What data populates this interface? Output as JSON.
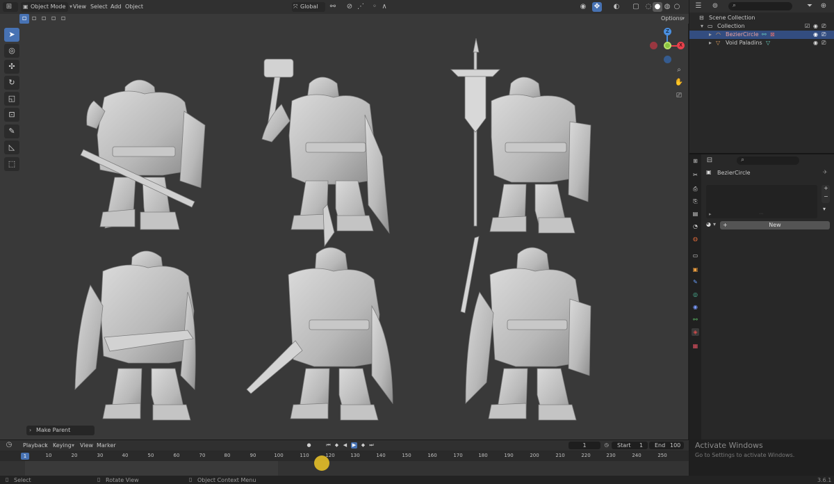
{
  "viewport": {
    "header": {
      "mode_label": "Object Mode",
      "menus": [
        "View",
        "Select",
        "Add",
        "Object"
      ],
      "transform_orientation": "Global",
      "options_label": "Options"
    },
    "toolbar": {
      "tools": [
        "select-box",
        "cursor",
        "move",
        "rotate",
        "scale",
        "transform",
        "annotate",
        "measure",
        "add-cube"
      ]
    },
    "gizmo": {
      "axes": [
        "X",
        "Y",
        "Z"
      ],
      "colors": {
        "x": "#e8414c",
        "y": "#8bc53f",
        "z": "#4a8fe0"
      }
    },
    "operator_panel_label": "Make Parent",
    "figures": [
      "sword-shield-paladin",
      "hammer-paladin",
      "banner-paladin",
      "rifle-paladin",
      "spear-paladin",
      "sword-shield-paladin-2"
    ]
  },
  "outliner": {
    "scene_collection": "Scene Collection",
    "collection": "Collection",
    "items": [
      {
        "name": "BezierCircle",
        "selected": true
      },
      {
        "name": "Void Paladins",
        "selected": false
      }
    ]
  },
  "properties": {
    "object_name": "BezierCircle",
    "new_button": "New",
    "tab_colors": [
      "#d7d7d7",
      "#d7d7d7",
      "#d7d7d7",
      "#d7d7d7",
      "#e06a3a",
      "#d7d7d7",
      "#f0a040",
      "#6aa0ff",
      "#4fbfa0",
      "#7a9aff",
      "#5fc46a",
      "#e05060",
      "#d94c4c"
    ]
  },
  "timeline": {
    "menus": [
      "Playback",
      "Keying",
      "View",
      "Marker"
    ],
    "current_frame": "1",
    "start_label": "Start",
    "start_value": "1",
    "end_label": "End",
    "end_value": "100",
    "ticks": [
      "10",
      "20",
      "30",
      "40",
      "50",
      "60",
      "70",
      "80",
      "90",
      "100",
      "110",
      "120",
      "130",
      "140",
      "150",
      "160",
      "170",
      "180",
      "190",
      "200",
      "210",
      "220",
      "230",
      "240",
      "250"
    ],
    "playhead_label": "1"
  },
  "statusbar": {
    "left": "Select",
    "middle": "Rotate View",
    "right": "Object Context Menu",
    "version": "3.6.1"
  },
  "watermark": {
    "title": "Activate Windows",
    "subtitle": "Go to Settings to activate Windows."
  },
  "colors": {
    "accent": "#4772b3",
    "viewport_bg": "#393939",
    "selection": "#334d80"
  }
}
